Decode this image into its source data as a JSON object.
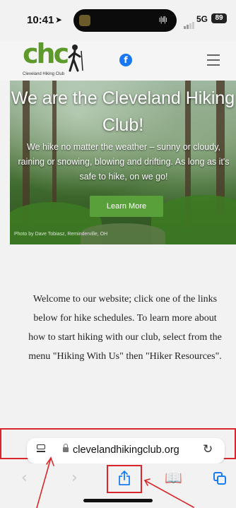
{
  "status_bar": {
    "time": "10:41",
    "network": "5G",
    "battery": "89"
  },
  "header": {
    "logo_text": "chc",
    "logo_subtitle": "Cleveland Hiking Club",
    "facebook_glyph": "f",
    "icons": [
      "facebook-icon",
      "hamburger-menu-icon"
    ]
  },
  "hero": {
    "title": "We are the Cleveland Hiking Club!",
    "text": "We hike no matter the weather – sunny or cloudy, raining or snowing, blowing and drifting. As long as it's safe to hike, on we go!",
    "button_label": "Learn More",
    "credit": "Photo by Dave Tobiasz, Reminderville, OH"
  },
  "welcome": {
    "text": "Welcome to our website; click one of the links below for hike schedules.  To learn more about how to start hiking with our club, select from the menu \"Hiking With Us\" then \"Hiker Resources\"."
  },
  "address_bar": {
    "url": "clevelandhikingclub.org",
    "icons": [
      "reader-view-icon",
      "lock-icon",
      "reload-icon"
    ]
  },
  "toolbar": {
    "icons": [
      "back-chevron-icon",
      "forward-chevron-icon",
      "share-icon",
      "bookmarks-icon",
      "tabs-icon"
    ],
    "back_glyph": "‹",
    "forward_glyph": "›",
    "bookmarks_glyph": "📖",
    "reload_glyph": "↻"
  },
  "colors": {
    "brand_green": "#5d9a2b",
    "annotation_red": "#d9262b",
    "ios_blue": "#1a7cf5",
    "button_green": "#5aa03a"
  }
}
